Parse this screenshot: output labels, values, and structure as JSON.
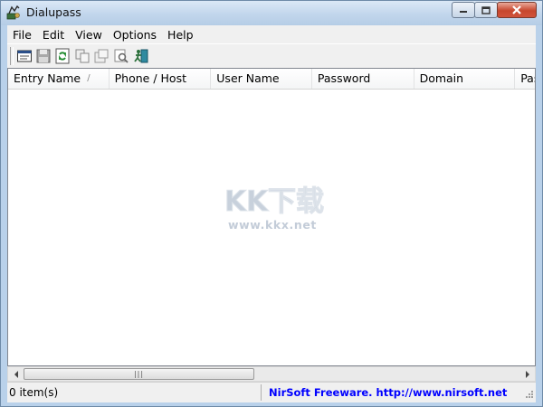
{
  "window": {
    "title": "Dialupass"
  },
  "menu": [
    "File",
    "Edit",
    "View",
    "Options",
    "Help"
  ],
  "columns": [
    "Entry Name",
    "Phone / Host",
    "User Name",
    "Password",
    "Domain",
    "Pas"
  ],
  "sort_indicator": "/",
  "watermark": {
    "logo_text": "KK下载",
    "url": "www.kkx.net"
  },
  "scrollbar": {
    "grip": "|||"
  },
  "status": {
    "items": "0 item(s)",
    "freeware": "NirSoft Freeware.  http://www.nirsoft.net"
  },
  "colors": {
    "link": "#0000ff",
    "watermark": "#c8d1dc",
    "titlebar": "#c2d6ec"
  }
}
